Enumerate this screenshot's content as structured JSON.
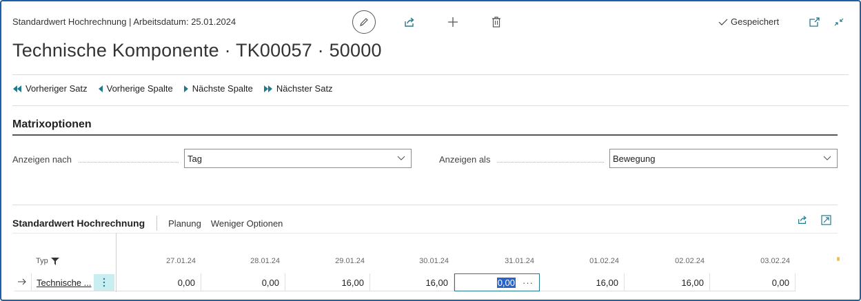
{
  "page": {
    "caption": "Standardwert Hochrechnung | Arbeitsdatum: 25.01.2024",
    "title": "Technische Komponente · TK00057 · 50000",
    "saved_label": "Gespeichert"
  },
  "nav": {
    "prev_record": "Vorheriger Satz",
    "prev_column": "Vorherige Spalte",
    "next_column": "Nächste Spalte",
    "next_record": "Nächster Satz"
  },
  "matrix": {
    "title": "Matrixoptionen",
    "show_by_label": "Anzeigen nach",
    "show_by_value": "Tag",
    "show_as_label": "Anzeigen als",
    "show_as_value": "Bewegung"
  },
  "part": {
    "title": "Standardwert Hochrechnung",
    "action_planning": "Planung",
    "action_less": "Weniger Optionen"
  },
  "grid": {
    "type_header": "Typ",
    "dates": [
      "27.01.24",
      "28.01.24",
      "29.01.24",
      "30.01.24",
      "31.01.24",
      "01.02.24",
      "02.02.24",
      "03.02.24"
    ],
    "row": {
      "type": "Technische ...",
      "values": [
        "0,00",
        "0,00",
        "16,00",
        "16,00",
        "0,00",
        "16,00",
        "16,00",
        "0,00"
      ]
    },
    "selected_ellipsis": "···"
  },
  "colors": {
    "accent": "#1f7a8c",
    "frame": "#1f5fa8",
    "selection": "#2a64c9"
  }
}
